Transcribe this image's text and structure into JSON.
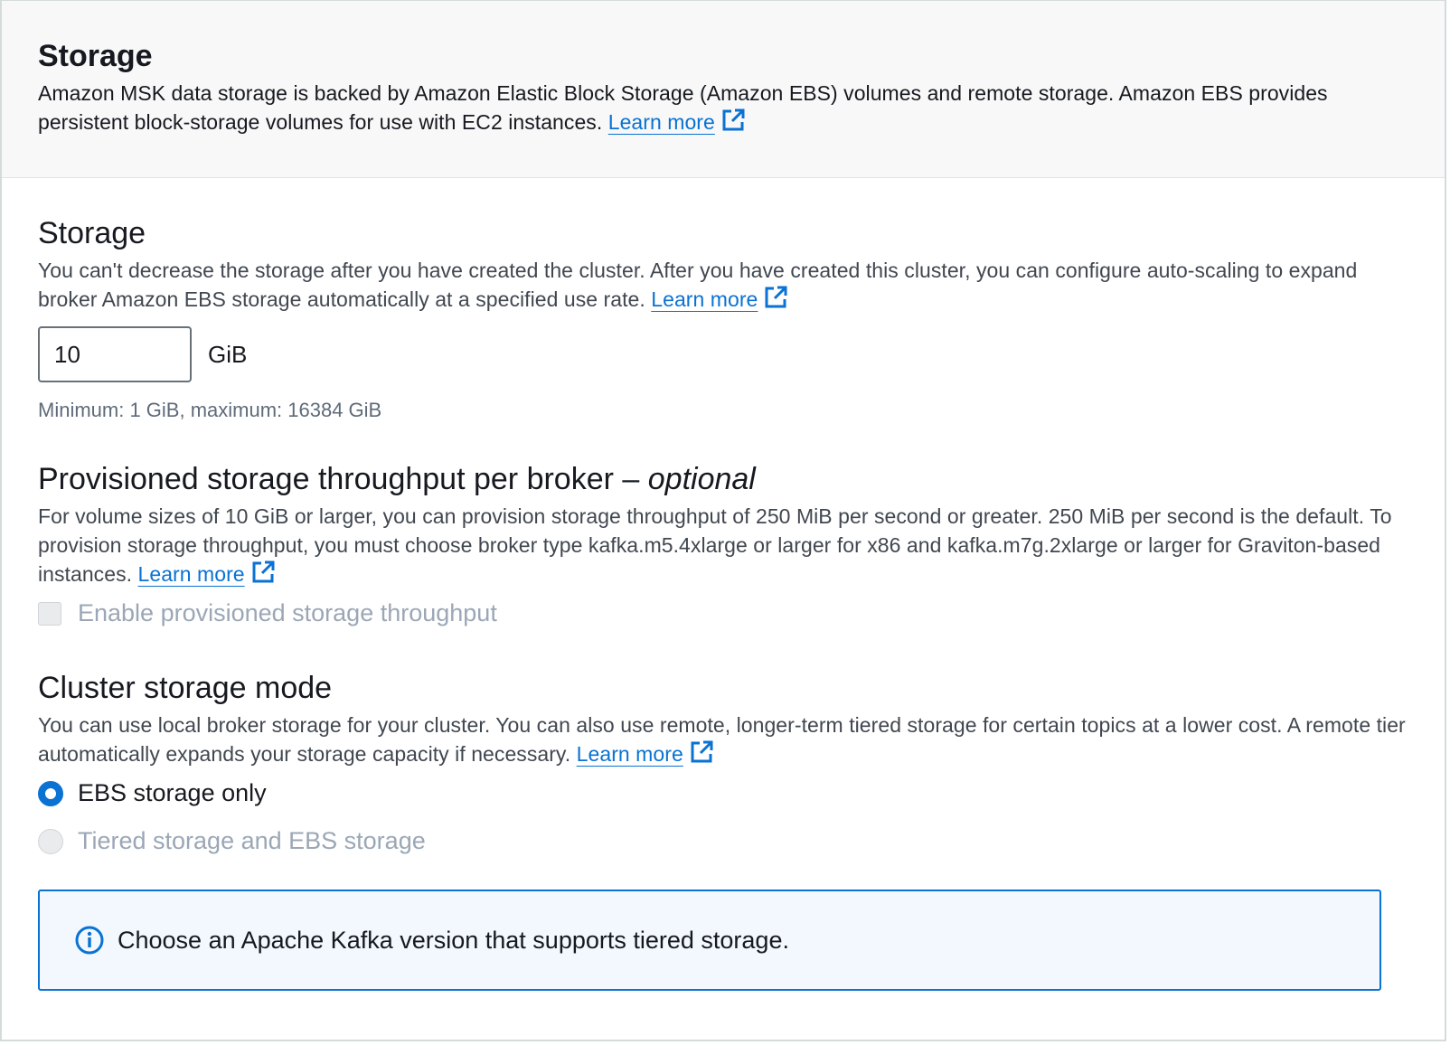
{
  "header": {
    "title": "Storage",
    "description": "Amazon MSK data storage is backed by Amazon Elastic Block Storage (Amazon EBS) volumes and remote storage. Amazon EBS provides persistent block-storage volumes for use with EC2 instances.",
    "learn_more": "Learn more"
  },
  "storage": {
    "title": "Storage",
    "description": "You can't decrease the storage after you have created the cluster. After you have created this cluster, you can configure auto-scaling to expand broker Amazon EBS storage automatically at a specified use rate.",
    "learn_more": "Learn more",
    "value": "10",
    "unit": "GiB",
    "constraint": "Minimum: 1 GiB, maximum: 16384 GiB"
  },
  "throughput": {
    "title": "Provisioned storage throughput per broker – ",
    "title_optional": "optional",
    "description": "For volume sizes of 10 GiB or larger, you can provision storage throughput of 250 MiB per second or greater. 250 MiB per second is the default. To provision storage throughput, you must choose broker type kafka.m5.4xlarge or larger for x86 and kafka.m7g.2xlarge or larger for Graviton-based instances.",
    "learn_more": "Learn more",
    "checkbox_label": "Enable provisioned storage throughput"
  },
  "mode": {
    "title": "Cluster storage mode",
    "description": "You can use local broker storage for your cluster. You can also use remote, longer-term tiered storage for certain topics at a lower cost. A remote tier automatically expands your storage capacity if necessary.",
    "learn_more": "Learn more",
    "options": [
      {
        "label": "EBS storage only",
        "selected": true,
        "disabled": false
      },
      {
        "label": "Tiered storage and EBS storage",
        "selected": false,
        "disabled": true
      }
    ]
  },
  "info": {
    "icon": "info-icon",
    "text": "Choose an Apache Kafka version that supports tiered storage."
  },
  "colors": {
    "link": "#0972d3",
    "info_border": "#0972d3",
    "info_bg": "#f2f8fd",
    "disabled_text": "#9ba7b6"
  }
}
